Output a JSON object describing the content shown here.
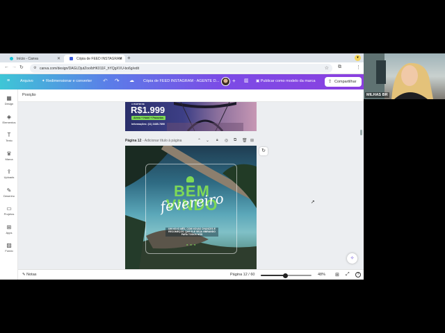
{
  "browser": {
    "tabs": [
      {
        "label": "Início - Canva",
        "active": false
      },
      {
        "label": "Cópia de FEED INSTAGRAM",
        "active": true
      }
    ],
    "new_tab": "+",
    "url": "canva.com/design/DAGLDjutZoo/bHK011F_hYQgXVU-bo6g/edit"
  },
  "toolbar": {
    "file": "Arquivo",
    "resize": "Redimensionar e converter",
    "doc_title": "Cópia de FEED INSTAGRAM - AGENTE D...",
    "add": "+",
    "publish": "Publicar como modelo da marca",
    "share": "Compartilhar"
  },
  "sidebar": {
    "items": [
      {
        "label": "Design",
        "icon": "design-icon"
      },
      {
        "label": "Elementos",
        "icon": "elements-icon"
      },
      {
        "label": "Texto",
        "icon": "text-icon"
      },
      {
        "label": "Marca",
        "icon": "brand-icon"
      },
      {
        "label": "Uploads",
        "icon": "upload-icon"
      },
      {
        "label": "Desenho",
        "icon": "draw-icon"
      },
      {
        "label": "Projetos",
        "icon": "folder-icon"
      },
      {
        "label": "Apps",
        "icon": "apps-icon"
      },
      {
        "label": "Fundo",
        "icon": "background-icon"
      }
    ]
  },
  "subbar": {
    "position": "Posição"
  },
  "page_prev": {
    "small_label": "A PARTIR DE",
    "price": "R$1.999",
    "badge": "Aéreo + Hotel + Passeios",
    "info": "Informações: (11) 3485-7890"
  },
  "page_header": {
    "label": "Página 12",
    "title_placeholder": "- Adicionar título à página"
  },
  "page_current": {
    "big_text": "BEM VINDO",
    "script_text": "fevereiro",
    "sub_text": "UM NOVO MÊS, COM NOVAS CHANCES E RECOMEÇOS. QUE ELE SEJA VIBRANDO PARA TODOS NÓS"
  },
  "bottom": {
    "notes": "Notas",
    "page_count": "Página 12 / 60",
    "zoom": "48%",
    "zoom_fraction": 0.48
  },
  "webcam": {
    "name": "MILHAS BR"
  },
  "colors": {
    "accent_purple": "#7b4ce6",
    "green_text": "#7ed957"
  }
}
